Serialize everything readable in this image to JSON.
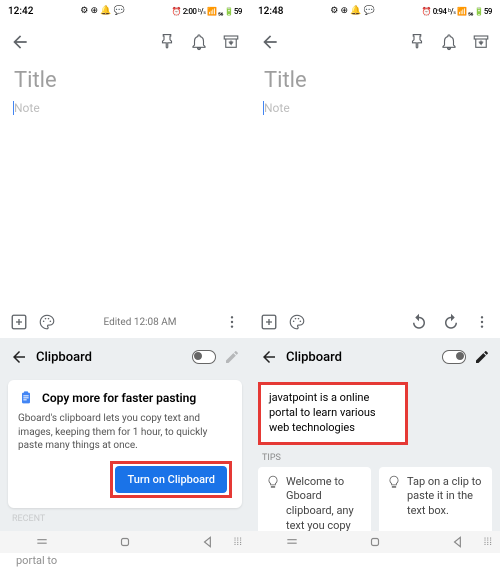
{
  "left": {
    "status": {
      "time": "12:42",
      "icons": "⚙ ⊕ 🔔 💬",
      "right": "⏰ 2:00 ᵇ/ₛ 📶 ₅₆ 🔋59"
    },
    "title_placeholder": "Title",
    "note_placeholder": "Note",
    "midbar": {
      "edited": "Edited 12:08 AM"
    },
    "clipboard": {
      "label": "Clipboard",
      "card_title": "Copy more for faster pasting",
      "card_body": "Gboard's clipboard lets you copy text and images, keeping them for 1 hour, to quickly paste many things at once.",
      "cta": "Turn on Clipboard",
      "recent": "RECENT",
      "recent_clip": "javatpoint is a online portal to"
    }
  },
  "right": {
    "status": {
      "time": "12:48",
      "icons": "⚙ ⊕ 🔔 💬",
      "right": "⏰ 0:94 ᵇ/ₛ 📶 ₅₆ 🔋59"
    },
    "title_placeholder": "Title",
    "note_placeholder": "Note",
    "midbar": {},
    "clipboard": {
      "label": "Clipboard",
      "selected_text": "javatpoint is a online portal to learn various web technologies",
      "tips_label": "TIPS",
      "tip1": "Welcome to Gboard clipboard, any text you copy",
      "tip2": "Tap on a clip to paste it in the text box."
    }
  }
}
